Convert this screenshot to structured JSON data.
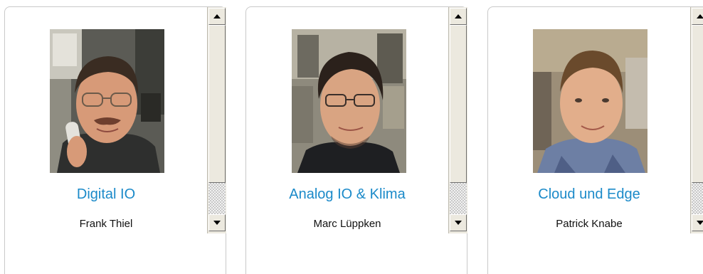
{
  "cards": [
    {
      "title": "Digital IO",
      "name": "Frank Thiel",
      "photo_icon": "portrait-photo-frank-thiel"
    },
    {
      "title": "Analog IO & Klima",
      "name": "Marc Lüppken",
      "photo_icon": "portrait-photo-marc-lueppken"
    },
    {
      "title": "Cloud und Edge",
      "name": "Patrick Knabe",
      "photo_icon": "portrait-photo-patrick-knabe"
    }
  ],
  "colors": {
    "title": "#1b8ac9",
    "name": "#111111",
    "card_border": "#c9c9c9",
    "scrollbar": "#ece9df"
  }
}
